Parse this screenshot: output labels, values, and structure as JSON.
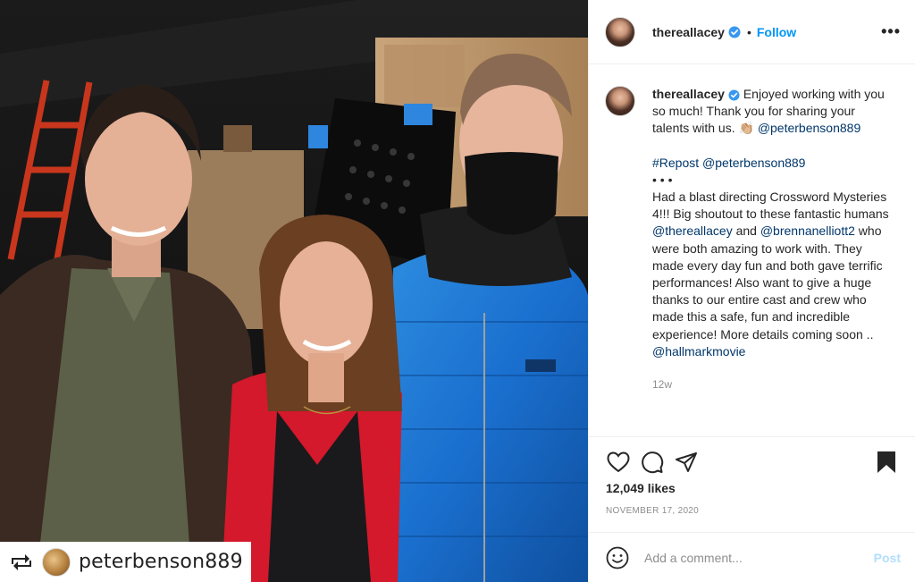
{
  "post": {
    "username": "thereallacey",
    "follow_label": "Follow",
    "dot": "•",
    "more": "•••",
    "caption_first": "Enjoyed working with you so much! Thank you for sharing your talents with us. 👏🏼",
    "caption_mention_1": "@peterbenson889",
    "repost_tag": "#Repost",
    "repost_mention": "@peterbenson889",
    "bullets": "• • •",
    "body_1": "Had a blast directing Crossword Mysteries 4!!! Big shoutout to these fantastic humans ",
    "body_mention_1": "@thereallacey",
    "body_2": " and ",
    "body_mention_2": "@brennanelliott2",
    "body_3": " who were both amazing to work with. They made every day fun and both gave terrific performances! Also want to give a huge thanks to our entire cast and crew who made this a safe, fun and incredible experience! More details coming soon .. ",
    "body_mention_3": "@hallmarkmovie",
    "time_ago": "12w",
    "likes": "12,049 likes",
    "date": "NOVEMBER 17, 2020",
    "comment_placeholder": "Add a comment...",
    "post_label": "Post"
  },
  "photo": {
    "repost_username": "peterbenson889"
  },
  "icons": {
    "verified": "verified-badge-icon",
    "heart": "heart-icon",
    "comment": "comment-icon",
    "share": "share-icon",
    "save": "bookmark-icon",
    "emoji": "emoji-icon",
    "repost": "repost-icon"
  },
  "colors": {
    "accent": "#0095f6",
    "link": "#00376b",
    "muted": "#8e8e8e",
    "post_disabled": "#b2dffc"
  }
}
